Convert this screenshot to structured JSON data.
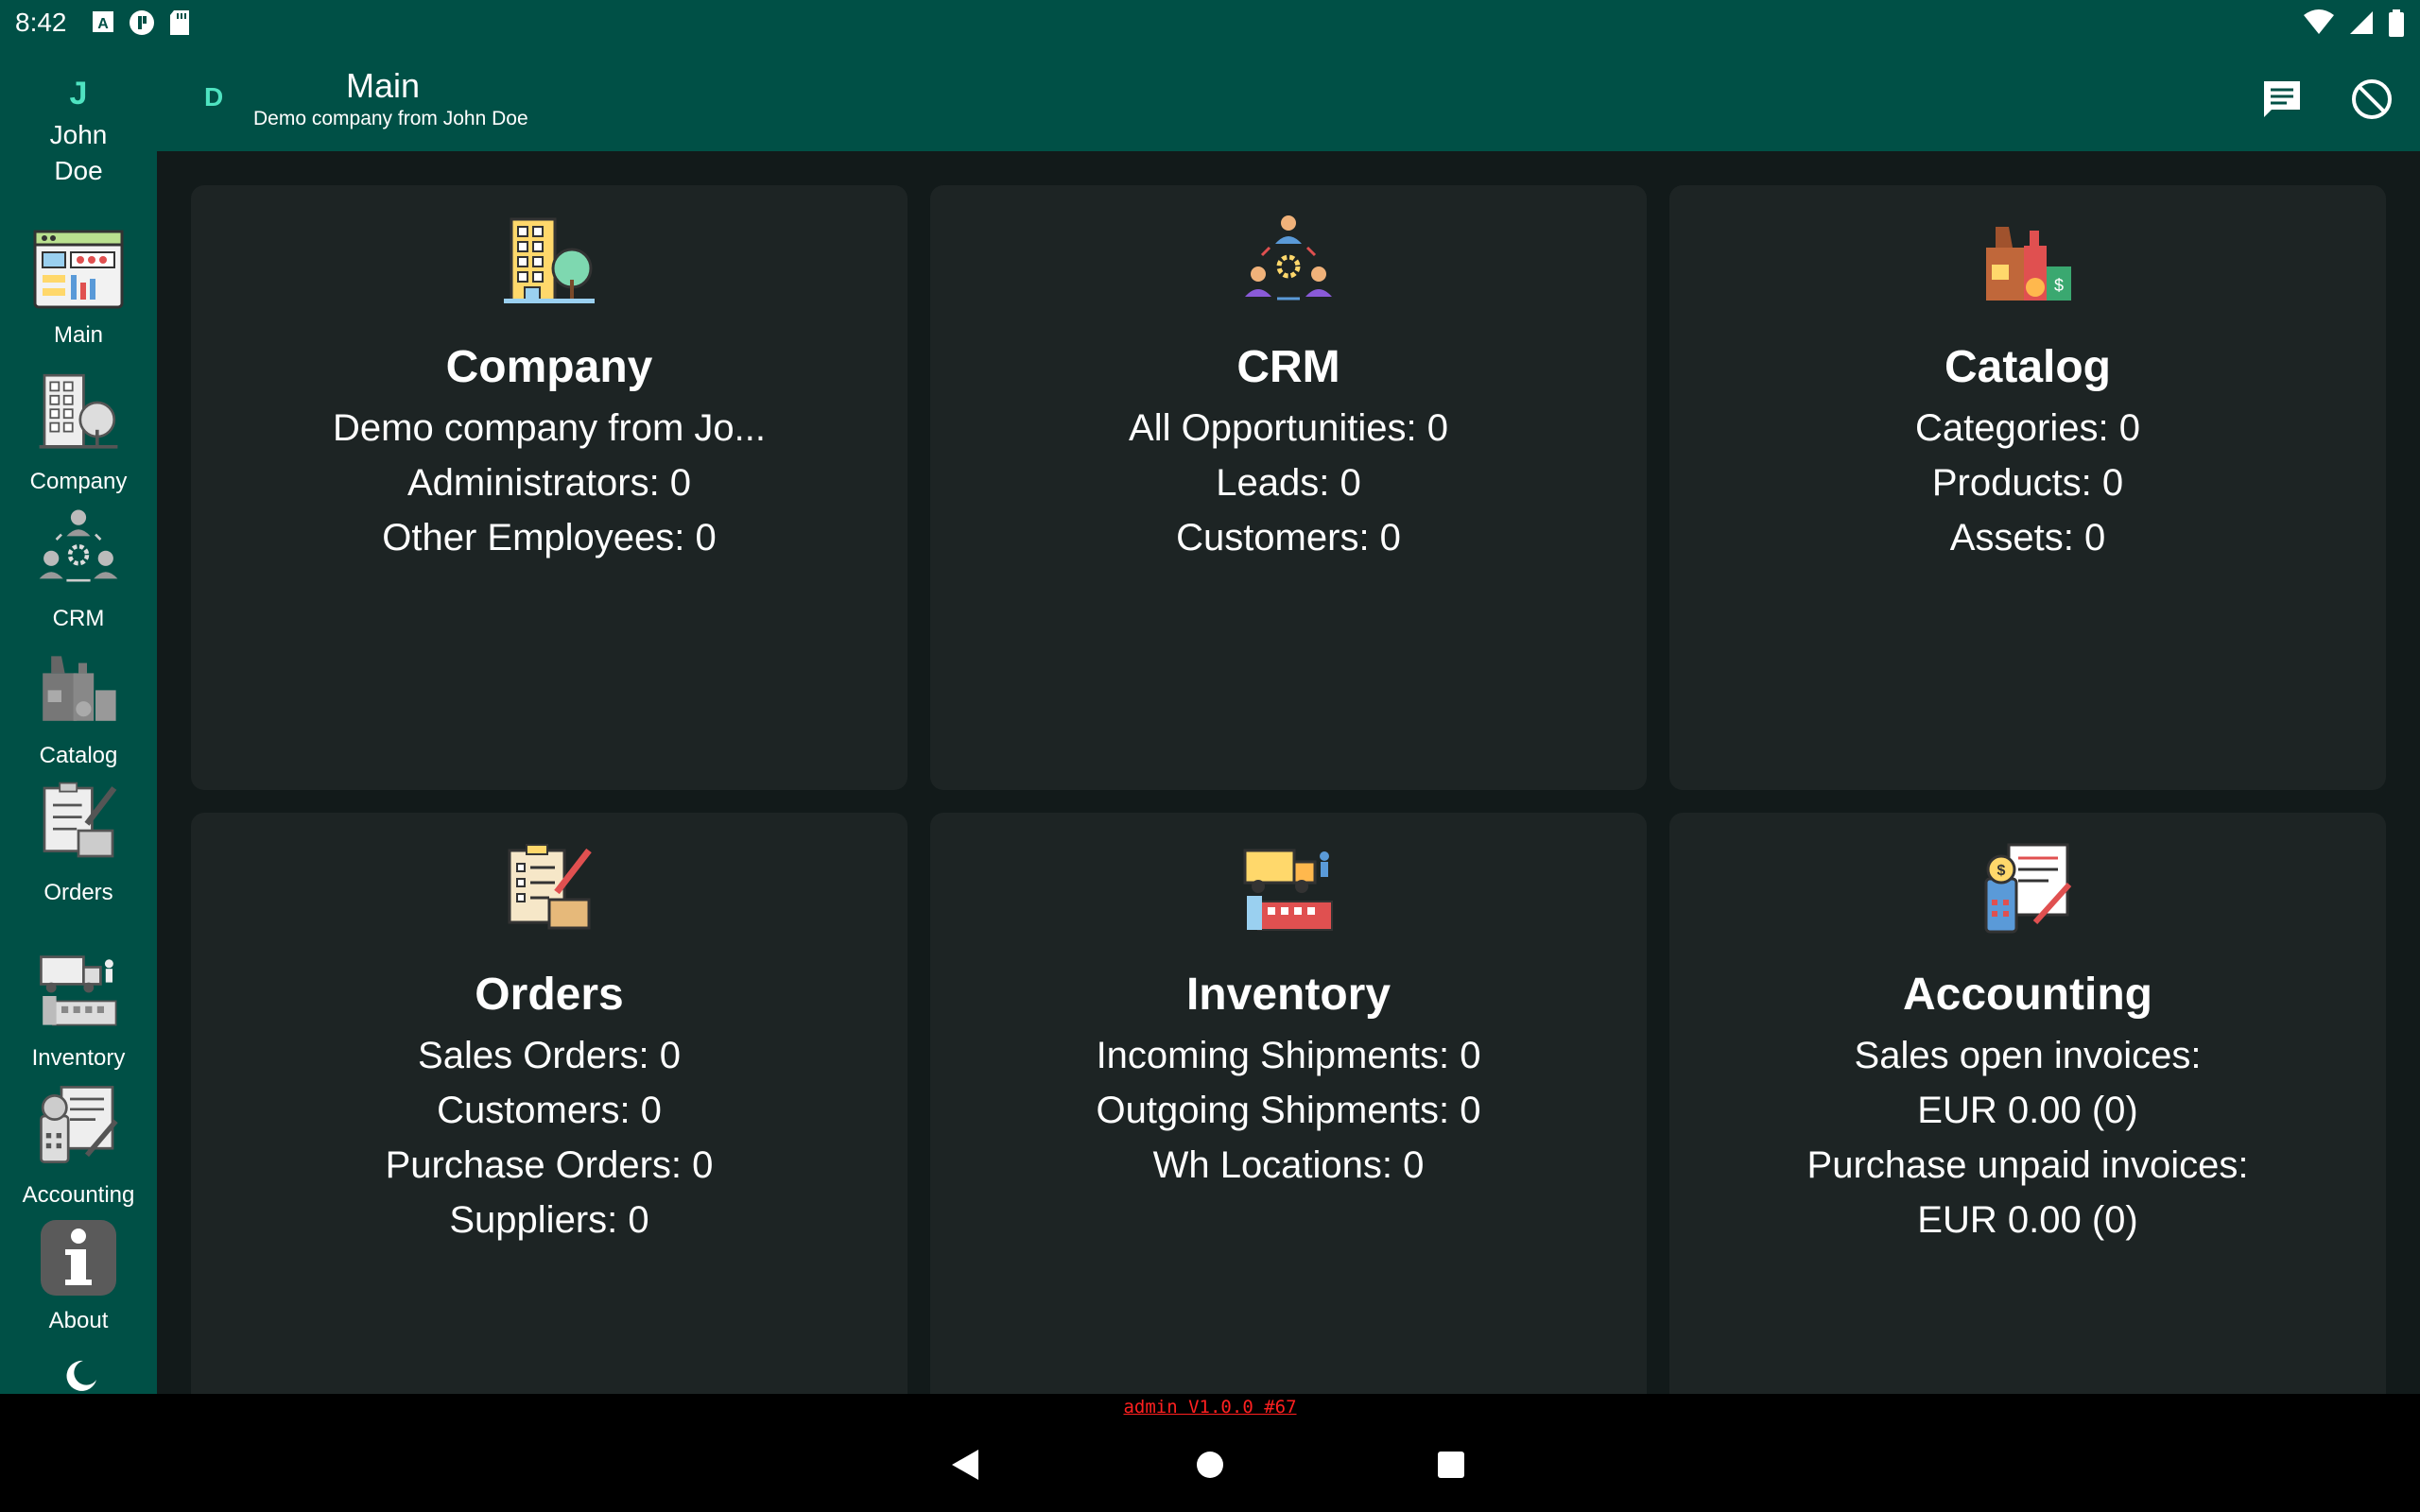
{
  "status_bar": {
    "time": "8:42",
    "left_icons": [
      "notification-a-icon",
      "notification-p-icon",
      "sd-card-icon"
    ],
    "right_icons": [
      "wifi-icon",
      "signal-icon",
      "battery-icon"
    ]
  },
  "user": {
    "initial": "J",
    "name_line1": "John",
    "name_line2": "Doe"
  },
  "header": {
    "company_initial": "D",
    "title": "Main",
    "subtitle": "Demo company from John Doe"
  },
  "header_actions": [
    "chat-icon",
    "logout-icon"
  ],
  "sidebar": {
    "items": [
      {
        "label": "Main",
        "icon": "dashboard-icon"
      },
      {
        "label": "Company",
        "icon": "building-icon"
      },
      {
        "label": "CRM",
        "icon": "crm-icon"
      },
      {
        "label": "Catalog",
        "icon": "catalog-icon"
      },
      {
        "label": "Orders",
        "icon": "orders-icon"
      },
      {
        "label": "Inventory",
        "icon": "inventory-icon"
      },
      {
        "label": "Accounting",
        "icon": "accounting-icon"
      },
      {
        "label": "About",
        "icon": "info-icon"
      }
    ],
    "theme_icon": "moon-icon"
  },
  "cards": [
    {
      "title": "Company",
      "icon": "building-icon",
      "lines": [
        "Demo company from Jo...",
        "Administrators: 0",
        "Other Employees: 0"
      ]
    },
    {
      "title": "CRM",
      "icon": "crm-icon",
      "lines": [
        "All Opportunities: 0",
        "Leads: 0",
        "Customers: 0"
      ]
    },
    {
      "title": "Catalog",
      "icon": "catalog-icon",
      "lines": [
        "Categories: 0",
        "Products: 0",
        "Assets: 0"
      ]
    },
    {
      "title": "Orders",
      "icon": "orders-icon",
      "lines": [
        "Sales Orders: 0",
        "Customers: 0",
        "Purchase Orders: 0",
        "Suppliers: 0"
      ]
    },
    {
      "title": "Inventory",
      "icon": "inventory-icon",
      "lines": [
        "Incoming Shipments: 0",
        "Outgoing Shipments: 0",
        "Wh Locations: 0"
      ]
    },
    {
      "title": "Accounting",
      "icon": "accounting-icon",
      "lines": [
        "Sales open invoices:",
        "EUR 0.00 (0)",
        "Purchase unpaid invoices:",
        "EUR 0.00 (0)"
      ]
    }
  ],
  "footer": {
    "version": "admin V1.0.0 #67"
  },
  "nav_bar": [
    "back-icon",
    "home-icon",
    "recents-icon"
  ],
  "colors": {
    "primary": "#005046",
    "background": "#121a1a",
    "card": "#1d2424",
    "accent": "#4fe3c1",
    "version_text": "#ff2020"
  }
}
